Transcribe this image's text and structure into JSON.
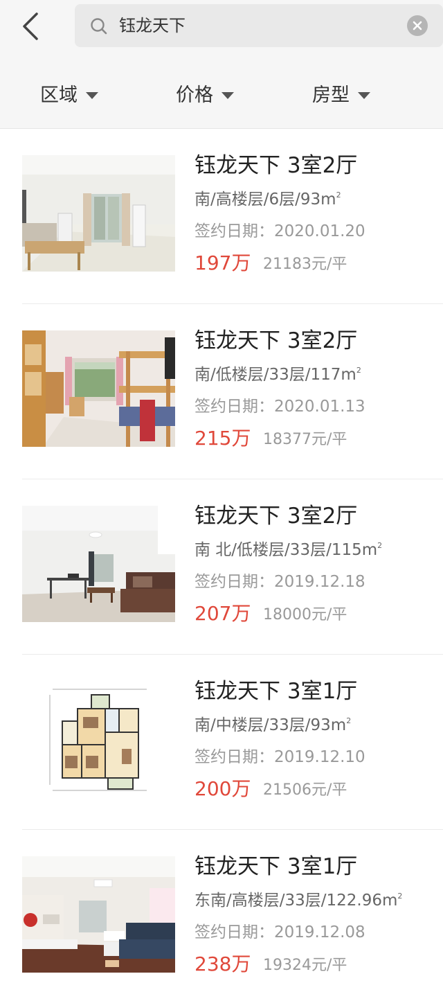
{
  "search": {
    "query": "钰龙天下"
  },
  "filters": [
    {
      "label": "区域"
    },
    {
      "label": "价格"
    },
    {
      "label": "房型"
    }
  ],
  "listings": [
    {
      "title": "钰龙天下 3室2厅",
      "desc": "南/高楼层/6层/93m",
      "area_unit_sup": "2",
      "date": "签约日期：2020.01.20",
      "price": "197万",
      "unit_price": "21183元/平",
      "photo": "living-room-photo"
    },
    {
      "title": "钰龙天下 3室2厅",
      "desc": "南/低楼层/33层/117m",
      "area_unit_sup": "2",
      "date": "签约日期：2020.01.13",
      "price": "215万",
      "unit_price": "18377元/平",
      "photo": "bedroom-photo"
    },
    {
      "title": "钰龙天下 3室2厅",
      "desc": "南 北/低楼层/33层/115m",
      "area_unit_sup": "2",
      "date": "签约日期：2019.12.18",
      "price": "207万",
      "unit_price": "18000元/平",
      "photo": "living-room-photo"
    },
    {
      "title": "钰龙天下 3室1厅",
      "desc": "南/中楼层/33层/93m",
      "area_unit_sup": "2",
      "date": "签约日期：2019.12.10",
      "price": "200万",
      "unit_price": "21506元/平",
      "photo": "floor-plan-image"
    },
    {
      "title": "钰龙天下 3室1厅",
      "desc": "东南/高楼层/33层/122.96m",
      "area_unit_sup": "2",
      "date": "签约日期：2019.12.08",
      "price": "238万",
      "unit_price": "19324元/平",
      "photo": "living-room-photo"
    }
  ],
  "colors": {
    "price": "#e0483a",
    "header_bg": "#f6f6f6",
    "search_bg": "#e9e9e9"
  }
}
